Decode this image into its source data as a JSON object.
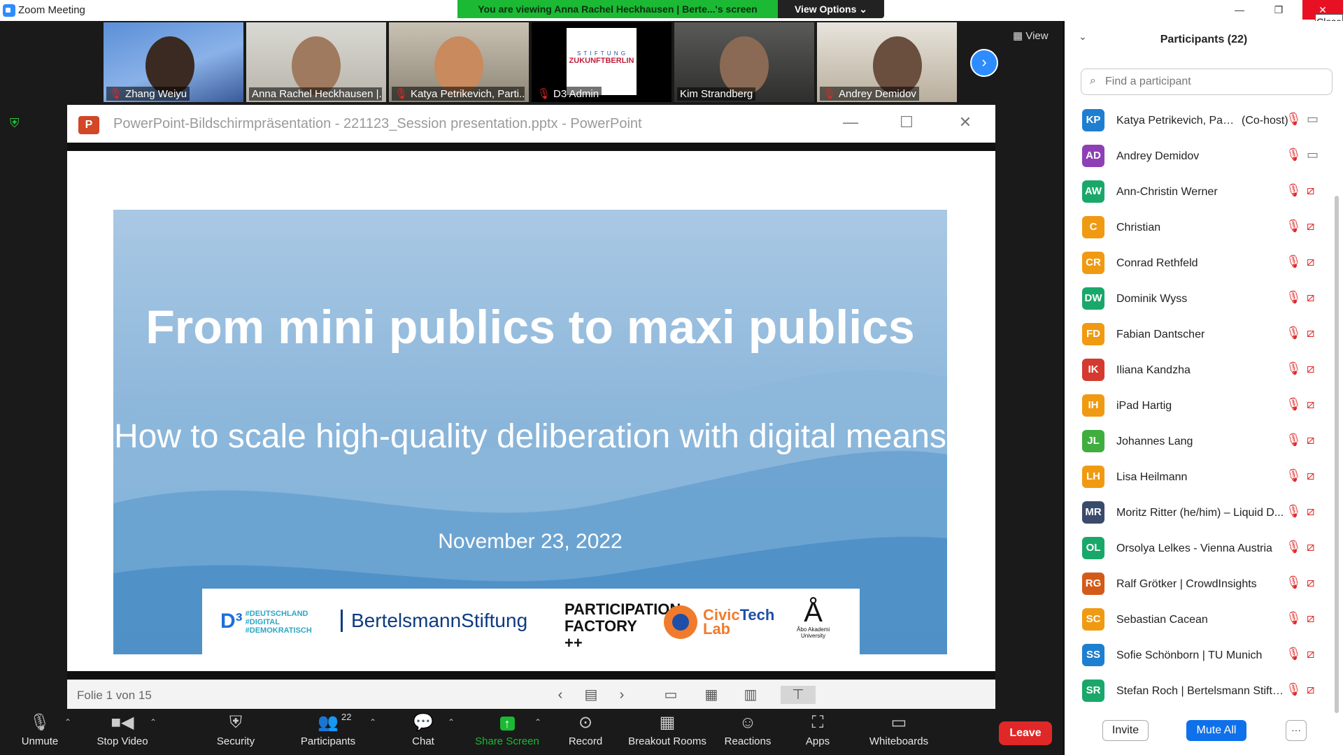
{
  "window": {
    "title": "Zoom Meeting",
    "banner": "You are viewing Anna Rachel Heckhausen | Berte...'s screen",
    "view_options": "View Options ⌄",
    "close_tooltip": "Close"
  },
  "video_strip": {
    "tiles": [
      {
        "name": "Zhang Weiyu",
        "muted": true
      },
      {
        "name": "Anna Rachel Heckhausen |...",
        "muted": false
      },
      {
        "name": "Katya Petrikevich, Parti...",
        "muted": true
      },
      {
        "name": "D3 Admin",
        "muted": true
      },
      {
        "name": "Kim Strandberg",
        "muted": false
      },
      {
        "name": "Andrey Demidov",
        "muted": true
      }
    ],
    "view_label": "View",
    "d3_logo_top": "S T I F T U N G",
    "d3_logo_bottom": "ZUKUNFTBERLIN"
  },
  "powerpoint": {
    "title": "PowerPoint-Bildschirmpräsentation  -  221123_Session presentation.pptx - PowerPoint",
    "slide_counter": "Folie 1 von 15",
    "slide": {
      "title": "From mini publics to maxi publics",
      "subtitle": "How to scale high-quality deliberation with digital means",
      "date": "November 23, 2022",
      "logos": {
        "d3": "D³",
        "d3_tag_1": "#DEUTSCHLAND",
        "d3_tag_2": "#DIGITAL",
        "d3_tag_3": "#DEMOKRATISCH",
        "bertelsmann": "BertelsmannStiftung",
        "participation_1": "PARTICIPATION",
        "participation_2": "FACTORY ++",
        "civictech_1": "Civic",
        "civictech_2": "Tech",
        "civictech_3": "Lab",
        "abo_mark": "Å",
        "abo_1": "Åbo Akademi",
        "abo_2": "University"
      }
    }
  },
  "toolbar": {
    "unmute": "Unmute",
    "stop_video": "Stop Video",
    "security": "Security",
    "participants": "Participants",
    "participants_count": "22",
    "chat": "Chat",
    "share_screen": "Share Screen",
    "record": "Record",
    "breakout_rooms": "Breakout Rooms",
    "reactions": "Reactions",
    "apps": "Apps",
    "whiteboards": "Whiteboards",
    "leave": "Leave"
  },
  "participants_panel": {
    "title": "Participants (22)",
    "search_placeholder": "Find a participant",
    "participants": [
      {
        "initials": "KP",
        "name": "Katya Petrikevich, Parti...",
        "role": "(Co-host)",
        "color": "#1e7fd0",
        "video_on": true
      },
      {
        "initials": "AD",
        "name": "Andrey Demidov",
        "role": "",
        "color": "#8e3fb5",
        "video_on": true
      },
      {
        "initials": "AW",
        "name": "Ann-Christin Werner",
        "role": "",
        "color": "#1aa86a",
        "video_on": false
      },
      {
        "initials": "C",
        "name": "Christian",
        "role": "",
        "color": "#f09a12",
        "video_on": false
      },
      {
        "initials": "CR",
        "name": "Conrad Rethfeld",
        "role": "",
        "color": "#f09a12",
        "video_on": false
      },
      {
        "initials": "DW",
        "name": "Dominik Wyss",
        "role": "",
        "color": "#1aa86a",
        "video_on": false
      },
      {
        "initials": "FD",
        "name": "Fabian Dantscher",
        "role": "",
        "color": "#f09a12",
        "video_on": false
      },
      {
        "initials": "IK",
        "name": "Iliana Kandzha",
        "role": "",
        "color": "#d43a2f",
        "video_on": false
      },
      {
        "initials": "IH",
        "name": "iPad Hartig",
        "role": "",
        "color": "#f09a12",
        "video_on": false
      },
      {
        "initials": "JL",
        "name": "Johannes Lang",
        "role": "",
        "color": "#3fae3f",
        "video_on": false
      },
      {
        "initials": "LH",
        "name": "Lisa Heilmann",
        "role": "",
        "color": "#f09a12",
        "video_on": false
      },
      {
        "initials": "MR",
        "name": "Moritz Ritter (he/him) – Liquid D...",
        "role": "",
        "color": "#3a4a6b",
        "video_on": false
      },
      {
        "initials": "OL",
        "name": "Orsolya Lelkes - Vienna Austria",
        "role": "",
        "color": "#1aa86a",
        "video_on": false
      },
      {
        "initials": "RG",
        "name": "Ralf Grötker | CrowdInsights",
        "role": "",
        "color": "#d45a1a",
        "video_on": false
      },
      {
        "initials": "SC",
        "name": "Sebastian Cacean",
        "role": "",
        "color": "#f09a12",
        "video_on": false
      },
      {
        "initials": "SS",
        "name": "Sofie Schönborn | TU Munich",
        "role": "",
        "color": "#1e7fd0",
        "video_on": false
      },
      {
        "initials": "SR",
        "name": "Stefan Roch | Bertelsmann Stiftung",
        "role": "",
        "color": "#1aa86a",
        "video_on": false
      }
    ],
    "invite": "Invite",
    "mute_all": "Mute All",
    "more": "···"
  }
}
